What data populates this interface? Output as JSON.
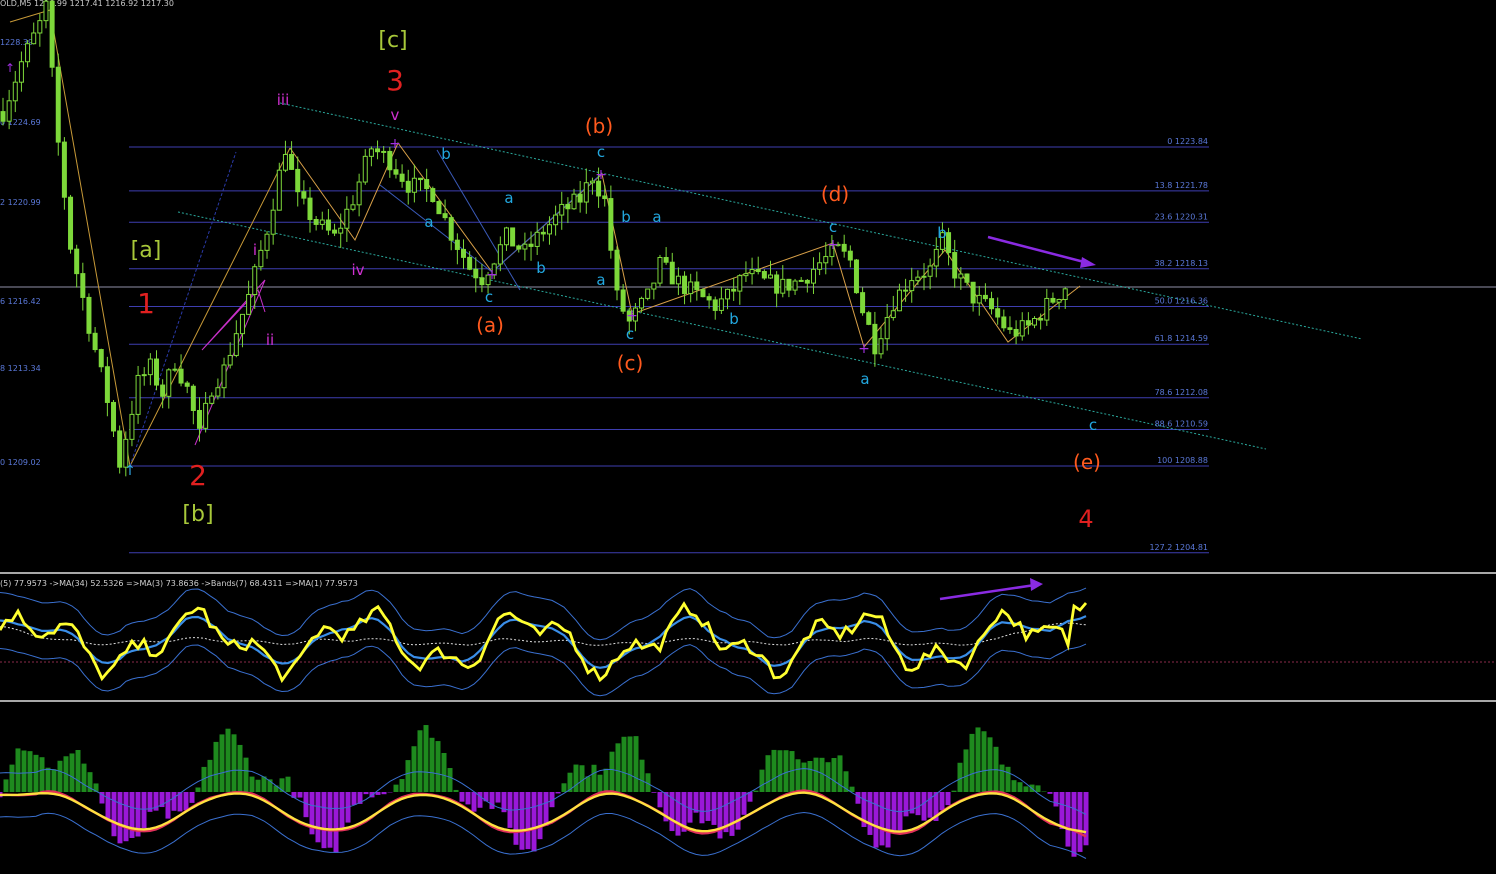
{
  "header": {
    "symbol_ohlc": "OLD,M5   1216.99 1217.41 1216.92 1217.30"
  },
  "left_axis_labels": [
    "1228.39",
    "0 1224.69",
    "2 1220.99",
    "6 1216.42",
    "8 1213.34",
    "0 1209.02"
  ],
  "fib_levels": [
    {
      "label": "0 1223.84",
      "price": 1223.84
    },
    {
      "label": "13.8 1221.78",
      "price": 1221.78
    },
    {
      "label": "23.6 1220.31",
      "price": 1220.31
    },
    {
      "label": "38.2 1218.13",
      "price": 1218.13
    },
    {
      "label": "50.0 1216.36",
      "price": 1216.36
    },
    {
      "label": "61.8 1214.59",
      "price": 1214.59
    },
    {
      "label": "78.6 1212.08",
      "price": 1212.08
    },
    {
      "label": "88.6 1210.59",
      "price": 1210.59
    },
    {
      "label": "100 1208.88",
      "price": 1208.88
    },
    {
      "label": "127.2 1204.81",
      "price": 1204.81
    }
  ],
  "wave_labels": {
    "c_bracket": "[c]",
    "a_bracket": "[a]",
    "b_bracket": "[b]",
    "red_1": "1",
    "red_2": "2",
    "red_3": "3",
    "red_4": "4",
    "roman_i": "i",
    "roman_ii": "ii",
    "roman_iii": "iii",
    "roman_iv": "iv",
    "roman_v": "v",
    "paren_a": "(a)",
    "paren_b": "(b)",
    "paren_c": "(c)",
    "paren_d": "(d)",
    "paren_e": "(e)",
    "minor_a": "a",
    "minor_b": "b",
    "minor_c": "c"
  },
  "osc1": {
    "label": "(5) 77.9573  ->MA(34) 52.5326  =>MA(3) 73.8636  ->Bands(7) 68.4311  =>MA(1) 77.9573"
  },
  "colors": {
    "candle": "#7dd83a",
    "fib": "#3e3eb0",
    "channel": "#2aa89c",
    "wave_red": "#e02020",
    "wave_orange": "#ff5a1e",
    "wave_lime": "#a8c83a",
    "wave_magenta": "#d030d0",
    "wave_cyan": "#22a8e0",
    "arrow": "#8a2be2",
    "osc_yellow": "#ffff30",
    "osc_blue": "#3a8ee8",
    "hist_green": "#1e8a1e",
    "hist_purple": "#9a18d8",
    "ma_pink": "#e0305a",
    "ma_orange": "#ffb020"
  },
  "chart_data": {
    "type": "candlestick",
    "title": "",
    "price_range": [
      1204.0,
      1230.5
    ],
    "close_path": [
      [
        0,
        1225.5
      ],
      [
        3,
        1227.8
      ],
      [
        6,
        1229.6
      ],
      [
        7,
        1230.4
      ],
      [
        9,
        1224.0
      ],
      [
        11,
        1219.2
      ],
      [
        14,
        1215.5
      ],
      [
        17,
        1212.0
      ],
      [
        19,
        1209.02
      ],
      [
        22,
        1212.8
      ],
      [
        24,
        1213.5
      ],
      [
        26,
        1212.3
      ],
      [
        28,
        1213.8
      ],
      [
        30,
        1212.5
      ],
      [
        32,
        1210.3
      ],
      [
        34,
        1212.6
      ],
      [
        36,
        1213.4
      ],
      [
        38,
        1215.2
      ],
      [
        40,
        1216.8
      ],
      [
        43,
        1220.0
      ],
      [
        46,
        1223.84
      ],
      [
        48,
        1221.4
      ],
      [
        51,
        1220.3
      ],
      [
        54,
        1219.6
      ],
      [
        57,
        1221.4
      ],
      [
        60,
        1223.8
      ],
      [
        63,
        1223.2
      ],
      [
        66,
        1222.1
      ],
      [
        70,
        1221.7
      ],
      [
        73,
        1219.8
      ],
      [
        76,
        1218.2
      ],
      [
        78,
        1217.7
      ],
      [
        82,
        1219.6
      ],
      [
        85,
        1218.9
      ],
      [
        88,
        1219.9
      ],
      [
        91,
        1220.8
      ],
      [
        94,
        1221.4
      ],
      [
        96,
        1222.5
      ],
      [
        98,
        1221.3
      ],
      [
        100,
        1216.8
      ],
      [
        102,
        1215.6
      ],
      [
        105,
        1216.8
      ],
      [
        107,
        1218.3
      ],
      [
        110,
        1217.5
      ],
      [
        113,
        1216.9
      ],
      [
        116,
        1216.4
      ],
      [
        118,
        1216.8
      ],
      [
        121,
        1217.9
      ],
      [
        124,
        1217.5
      ],
      [
        127,
        1217.3
      ],
      [
        130,
        1217.6
      ],
      [
        133,
        1218.4
      ],
      [
        136,
        1219.0
      ],
      [
        138,
        1218.5
      ],
      [
        140,
        1216.2
      ],
      [
        142,
        1214.59
      ],
      [
        145,
        1216.6
      ],
      [
        148,
        1217.8
      ],
      [
        151,
        1218.1
      ],
      [
        153,
        1219.4
      ],
      [
        155,
        1218.0
      ],
      [
        158,
        1216.8
      ],
      [
        161,
        1216.2
      ],
      [
        164,
        1215.1
      ],
      [
        167,
        1215.4
      ],
      [
        170,
        1216.4
      ],
      [
        173,
        1217.3
      ]
    ],
    "osc1_series": [
      "Oscillator",
      "MA(34)",
      "MA(3)",
      "Bands(7)",
      "MA(1)"
    ],
    "osc2_series": [
      "Histogram",
      "MA",
      "Signal",
      "Bands"
    ]
  }
}
